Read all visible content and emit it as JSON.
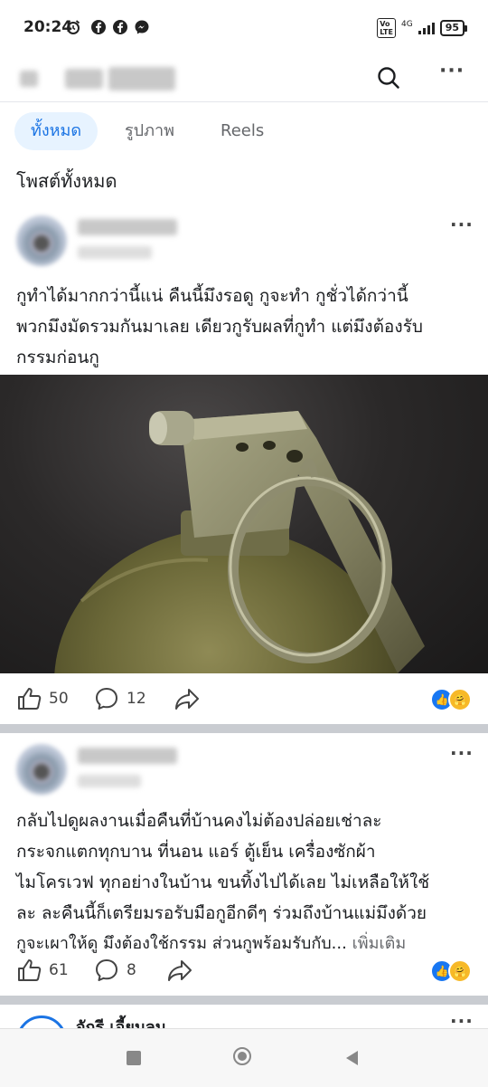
{
  "status_bar": {
    "time": "20:24",
    "network": "4G",
    "battery": "95"
  },
  "header": {
    "icons": [
      "search-icon",
      "more-icon"
    ]
  },
  "tabs": [
    {
      "label": "ทั้งหมด",
      "active": true
    },
    {
      "label": "รูปภาพ",
      "active": false
    },
    {
      "label": "Reels",
      "active": false
    }
  ],
  "section_title": "โพสต์ทั้งหมด",
  "posts": [
    {
      "text_lines": [
        "กูทำได้มากกว่านี้แน่ คืนนี้มึงรอดู กูจะทำ กูชั่วได้กว่านี้",
        "พวกมึงมัดรวมกันมาเลย เดียวกูรับผลที่กูทำ แต่มึงต้องรับ",
        "กรรมก่อนกู"
      ],
      "likes": "50",
      "comments": "12"
    },
    {
      "text_lines": [
        "กลับไปดูผลงานเมื่อคืนที่บ้านคงไม่ต้องปล่อยเช่าละ",
        "กระจกแตกทุกบาน ที่นอน แอร์ ตู้เย็น เครื่องซักผ้า",
        "ไมโครเวฟ ทุกอย่างในบ้าน ขนทิ้งไปได้เลย ไม่เหลือให้ใช้",
        "ละ ละคืนนี้ก็เตรียมรอรับมือกูอีกดีๆ ร่วมถึงบ้านแม่มึงด้วย",
        "กูจะเผาให้ดู มึงต้องใช้กรรม ส่วนกูพร้อมรับกับ..."
      ],
      "see_more": "เพิ่มเติม",
      "likes": "61",
      "comments": "8"
    }
  ],
  "third_post_name": "จักรี เอี้ยมลม",
  "colors": {
    "accent": "#1b74e4",
    "tab_bg": "#e7f3ff",
    "like_blue": "#1877f2"
  }
}
